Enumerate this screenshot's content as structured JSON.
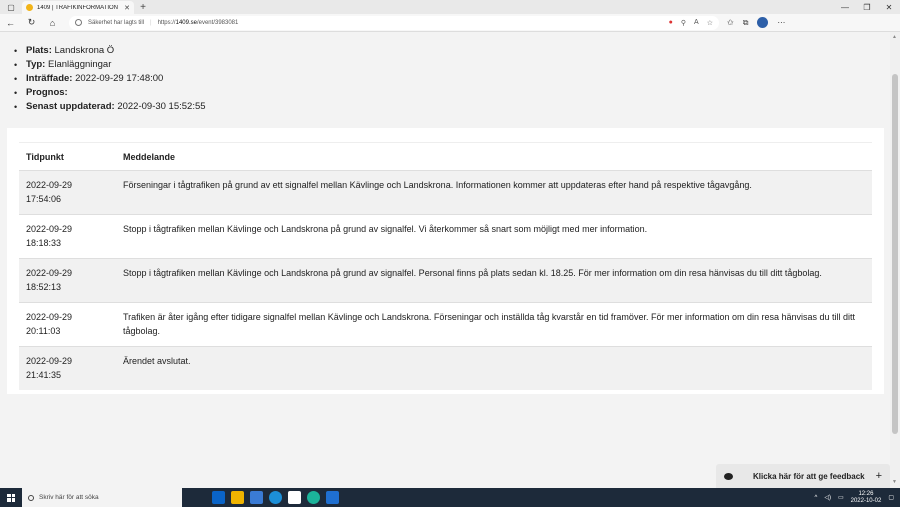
{
  "browser": {
    "tab_title": "1409 | TRAFIKINFORMATION",
    "security_text": "Säkerhet har lagts till",
    "url_prefix": "https://",
    "url_domain": "1409.se",
    "url_path": "/event/3983081"
  },
  "details": {
    "plats_label": "Plats:",
    "plats_value": "Landskrona Ö",
    "typ_label": "Typ:",
    "typ_value": "Elanläggningar",
    "intraffade_label": "Inträffade:",
    "intraffade_value": "2022-09-29 17:48:00",
    "prognos_label": "Prognos:",
    "prognos_value": "",
    "uppdaterad_label": "Senast uppdaterad:",
    "uppdaterad_value": "2022-09-30 15:52:55"
  },
  "table": {
    "headers": [
      "Tidpunkt",
      "Meddelande"
    ],
    "rows": [
      {
        "date": "2022-09-29",
        "time": "17:54:06",
        "message": "Förseningar i tågtrafiken på grund av ett signalfel mellan Kävlinge och Landskrona. Informationen kommer att uppdateras efter hand på respektive tågavgång."
      },
      {
        "date": "2022-09-29",
        "time": "18:18:33",
        "message": "Stopp i tågtrafiken mellan Kävlinge och Landskrona på grund av signalfel. Vi återkommer så snart som möjligt med mer information."
      },
      {
        "date": "2022-09-29",
        "time": "18:52:13",
        "message": "Stopp i tågtrafiken mellan Kävlinge och Landskrona på grund av signalfel. Personal finns på plats sedan kl. 18.25. För mer information om din resa hänvisas du till ditt tågbolag."
      },
      {
        "date": "2022-09-29",
        "time": "20:11:03",
        "message": "Trafiken är åter igång efter tidigare signalfel mellan Kävlinge och Landskrona. Förseningar och inställda tåg kvarstår en tid framöver. För mer information om din resa hänvisas du till ditt tågbolag."
      },
      {
        "date": "2022-09-29",
        "time": "21:41:35",
        "message": "Ärendet avslutat."
      }
    ]
  },
  "feedback": {
    "label": "Klicka här för att ge feedback",
    "plus": "+"
  },
  "taskbar": {
    "search_placeholder": "Skriv här för att söka",
    "time": "12:26",
    "date": "2022-10-02"
  }
}
